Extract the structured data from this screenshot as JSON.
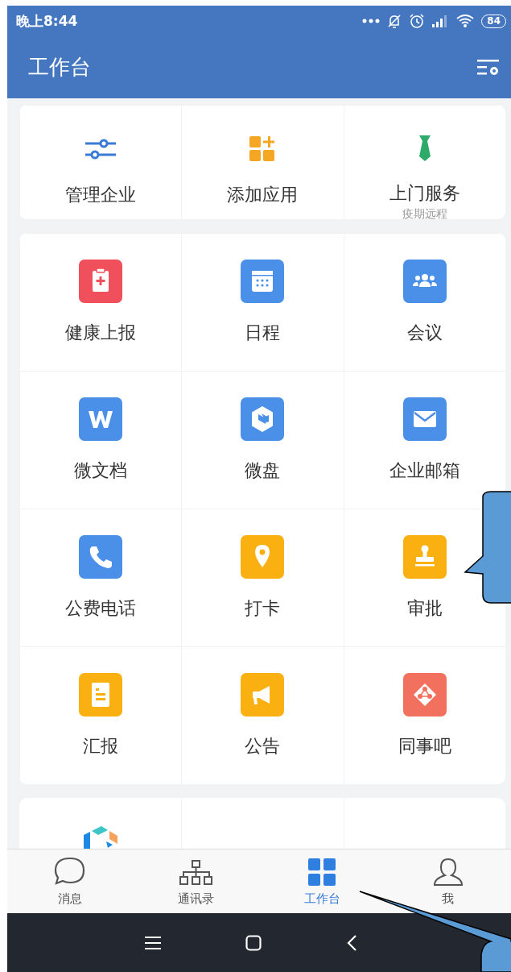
{
  "status_bar": {
    "time": "晚上8:44",
    "battery": "84"
  },
  "header": {
    "title": "工作台"
  },
  "quick_actions": [
    {
      "label": "管理企业",
      "kind": "sliders"
    },
    {
      "label": "添加应用",
      "kind": "add-grid"
    },
    {
      "label": "上门服务",
      "kind": "tie",
      "subtitle": "疫期远程"
    }
  ],
  "apps": [
    {
      "label": "健康上报",
      "kind": "health",
      "color": "#f0505c"
    },
    {
      "label": "日程",
      "kind": "calendar",
      "color": "#4a90e8"
    },
    {
      "label": "会议",
      "kind": "meeting",
      "color": "#4a90e8"
    },
    {
      "label": "微文档",
      "kind": "doc",
      "color": "#4a90e8"
    },
    {
      "label": "微盘",
      "kind": "disk",
      "color": "#4a90e8"
    },
    {
      "label": "企业邮箱",
      "kind": "mail",
      "color": "#4a90e8"
    },
    {
      "label": "公费电话",
      "kind": "phone",
      "color": "#4a90e8"
    },
    {
      "label": "打卡",
      "kind": "pin",
      "color": "#fbb012"
    },
    {
      "label": "审批",
      "kind": "stamp",
      "color": "#fbb012"
    },
    {
      "label": "汇报",
      "kind": "report",
      "color": "#fbb012"
    },
    {
      "label": "公告",
      "kind": "megaphone",
      "color": "#fbb012"
    },
    {
      "label": "同事吧",
      "kind": "network",
      "color": "#f2705e"
    }
  ],
  "tabs": [
    {
      "label": "消息",
      "kind": "chat",
      "selected": false
    },
    {
      "label": "通讯录",
      "kind": "org",
      "selected": false
    },
    {
      "label": "工作台",
      "kind": "grid",
      "selected": true
    },
    {
      "label": "我",
      "kind": "person",
      "selected": false
    }
  ]
}
